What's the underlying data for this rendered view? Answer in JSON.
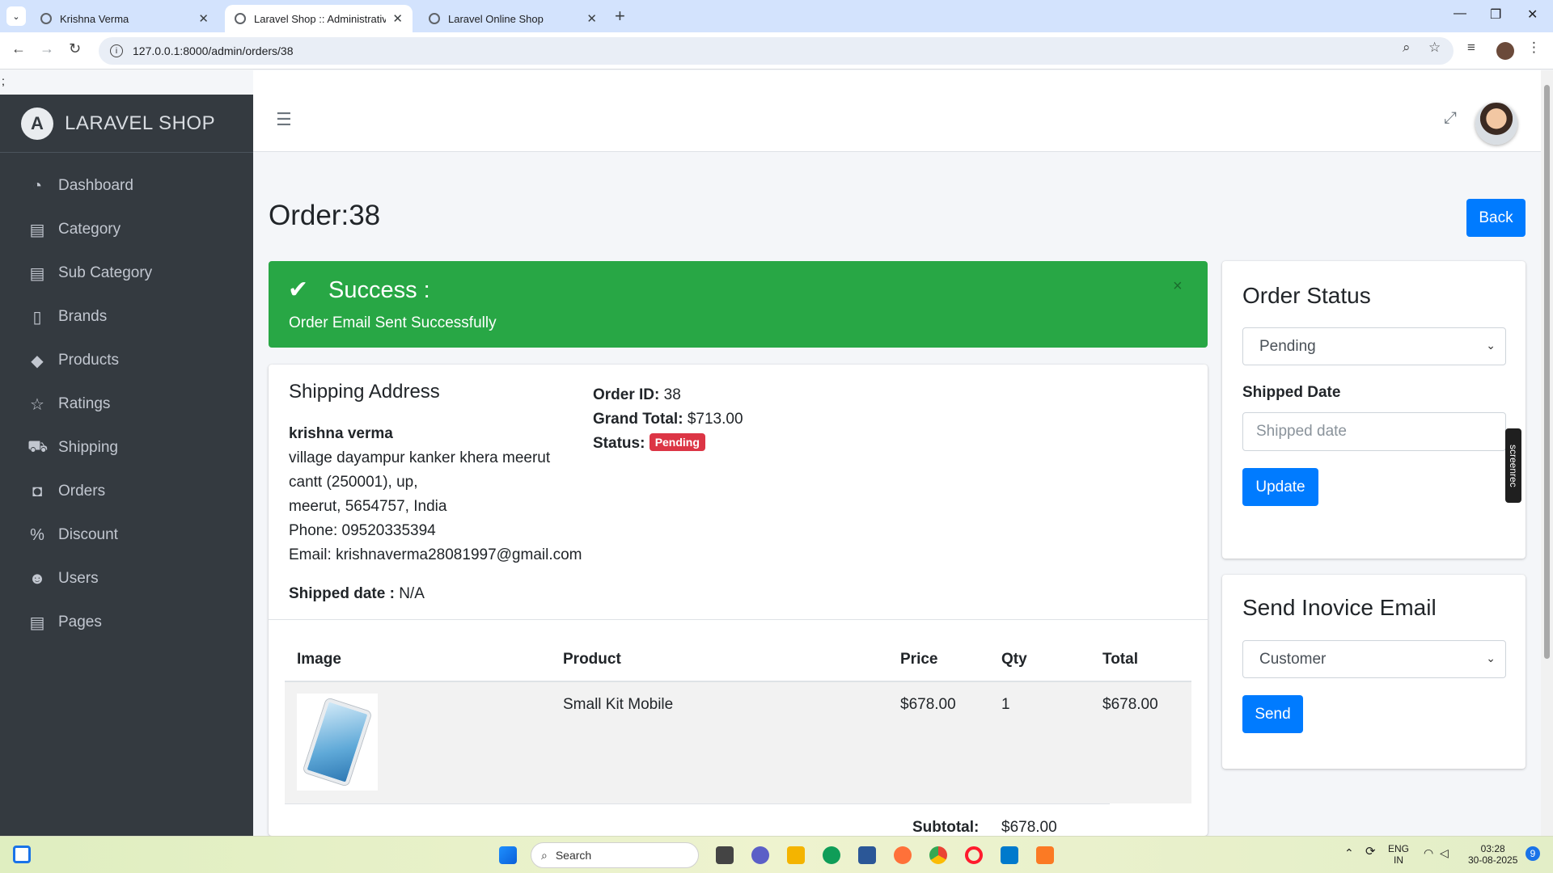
{
  "browser": {
    "tabs": [
      {
        "title": "Krishna Verma"
      },
      {
        "title": "Laravel Shop :: Administrative P"
      },
      {
        "title": "Laravel Online Shop"
      }
    ],
    "url": "127.0.0.1:8000/admin/orders/38"
  },
  "stray_text": ";",
  "sidebar": {
    "brand": "LARAVEL SHOP",
    "items": [
      {
        "label": "Dashboard",
        "icon": "dashboard-icon",
        "glyph": "◔"
      },
      {
        "label": "Category",
        "icon": "file-icon",
        "glyph": "▤"
      },
      {
        "label": "Sub Category",
        "icon": "file-icon",
        "glyph": "▤"
      },
      {
        "label": "Brands",
        "icon": "book-icon",
        "glyph": "▯"
      },
      {
        "label": "Products",
        "icon": "tag-icon",
        "glyph": "◆"
      },
      {
        "label": "Ratings",
        "icon": "star-icon",
        "glyph": "☆"
      },
      {
        "label": "Shipping",
        "icon": "truck-icon",
        "glyph": "⛟"
      },
      {
        "label": "Orders",
        "icon": "bag-icon",
        "glyph": "◘"
      },
      {
        "label": "Discount",
        "icon": "percent-icon",
        "glyph": "%"
      },
      {
        "label": "Users",
        "icon": "users-icon",
        "glyph": "☻"
      },
      {
        "label": "Pages",
        "icon": "file-icon",
        "glyph": "▤"
      }
    ]
  },
  "page": {
    "title": "Order:38",
    "back_label": "Back"
  },
  "alert": {
    "heading": "Success :",
    "message": "Order Email Sent Successfully",
    "close": "×"
  },
  "shipping": {
    "title": "Shipping Address",
    "name": "krishna verma",
    "address_line1": "village dayampur kanker khera meerut",
    "address_line2": "cantt (250001), up,",
    "address_line3": "meerut, 5654757, India",
    "phone": "Phone: 09520335394",
    "email": "Email: krishnaverma28081997@gmail.com",
    "shipped_label": "Shipped date :",
    "shipped_value": "N/A"
  },
  "order": {
    "id_label": "Order ID:",
    "id_value": "38",
    "total_label": "Grand Total:",
    "total_value": "$713.00",
    "status_label": "Status:",
    "status_value": "Pending"
  },
  "table": {
    "headers": [
      "Image",
      "Product",
      "Price",
      "Qty",
      "Total"
    ],
    "rows": [
      {
        "product": "Small Kit Mobile",
        "price": "$678.00",
        "qty": "1",
        "total": "$678.00"
      }
    ],
    "subtotal_label": "Subtotal:",
    "subtotal_value": "$678.00"
  },
  "status_card": {
    "title": "Order Status",
    "selected": "Pending",
    "shipped_label": "Shipped Date",
    "shipped_placeholder": "Shipped date",
    "update_label": "Update"
  },
  "email_card": {
    "title": "Send Inovice Email",
    "selected": "Customer",
    "send_label": "Send"
  },
  "overlay": {
    "screenrec": "screenrec"
  },
  "taskbar": {
    "search": "Search",
    "lang1": "ENG",
    "lang2": "IN",
    "time": "03:28",
    "date": "30-08-2025",
    "notif": "9"
  },
  "colors": {
    "sidebar": "#343a40",
    "primary": "#007bff",
    "success": "#28a745",
    "danger": "#dc3545"
  }
}
